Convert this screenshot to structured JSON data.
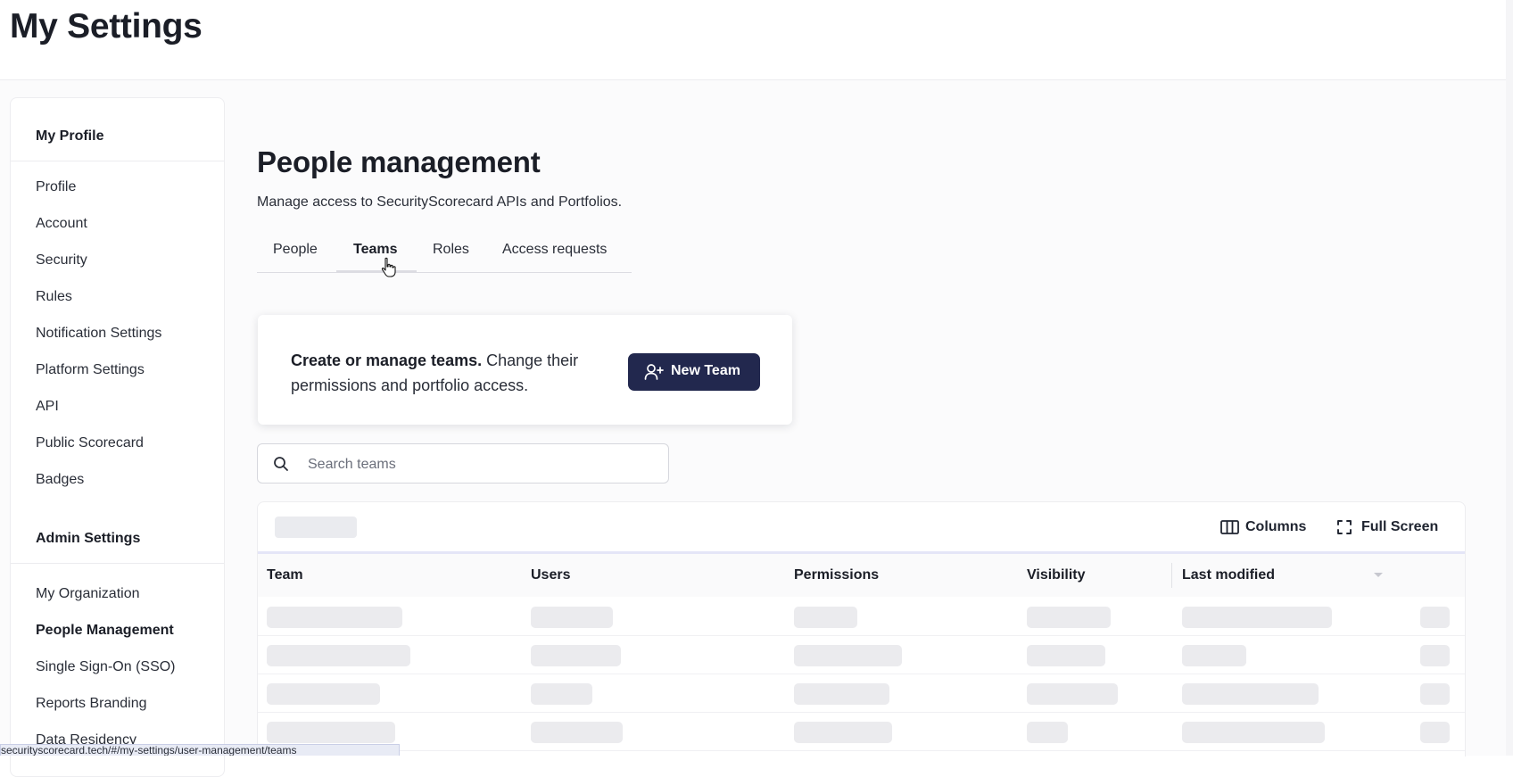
{
  "header": {
    "title": "My Settings"
  },
  "sidebar": {
    "sections": [
      {
        "label": "My Profile"
      },
      {
        "label": "Admin Settings"
      }
    ],
    "profile_items": [
      {
        "label": "Profile"
      },
      {
        "label": "Account"
      },
      {
        "label": "Security"
      },
      {
        "label": "Rules"
      },
      {
        "label": "Notification Settings"
      },
      {
        "label": "Platform Settings"
      },
      {
        "label": "API"
      },
      {
        "label": "Public Scorecard"
      },
      {
        "label": "Badges"
      }
    ],
    "admin_items": [
      {
        "label": "My Organization"
      },
      {
        "label": "People Management",
        "active": true
      },
      {
        "label": "Single Sign-On (SSO)"
      },
      {
        "label": "Reports Branding"
      },
      {
        "label": "Data Residency"
      }
    ]
  },
  "main": {
    "title": "People management",
    "subtitle": "Manage access to SecurityScorecard APIs and Portfolios.",
    "tabs": [
      {
        "label": "People"
      },
      {
        "label": "Teams",
        "active": true
      },
      {
        "label": "Roles"
      },
      {
        "label": "Access requests"
      }
    ],
    "promo": {
      "bold": "Create or manage teams.",
      "text": "Change their permissions and portfolio access.",
      "button": "New Team"
    },
    "search": {
      "placeholder": "Search teams",
      "value": ""
    },
    "table": {
      "toolbar": {
        "columns": "Columns",
        "fullscreen": "Full Screen"
      },
      "columns": [
        "Team",
        "Users",
        "Permissions",
        "Visibility",
        "Last modified"
      ],
      "loading": true
    }
  },
  "status_bar": {
    "url": "securityscorecard.tech/#/my-settings/user-management/teams"
  },
  "colors": {
    "primary_button": "#22284e",
    "skeleton": "#ebebee",
    "accent_line": "#e4e5f7"
  },
  "icons": [
    "add-user-icon",
    "search-icon",
    "columns-icon",
    "fullscreen-icon",
    "sort-arrow-icon",
    "pointer-cursor-icon"
  ]
}
